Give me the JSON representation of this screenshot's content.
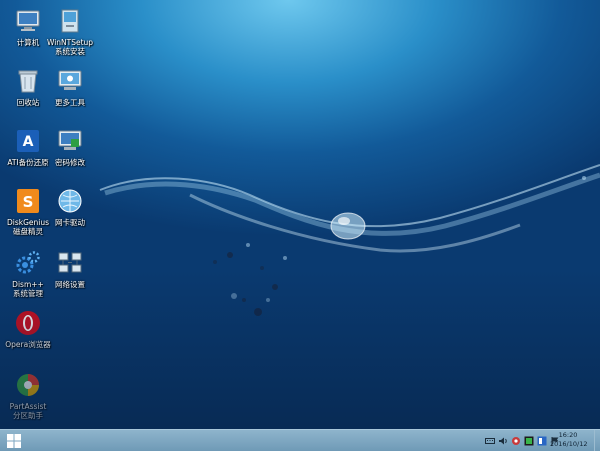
{
  "desktop": {
    "icons": [
      {
        "label_lines": [
          "计算机"
        ],
        "icon": "computer-icon"
      },
      {
        "label_lines": [
          "WinNTSetup",
          "系统安装"
        ],
        "icon": "setup-icon"
      },
      {
        "label_lines": [
          "回收站"
        ],
        "icon": "recycle-bin-icon"
      },
      {
        "label_lines": [
          "更多工具"
        ],
        "icon": "tools-icon"
      },
      {
        "label_lines": [
          "ATI备份还原"
        ],
        "icon": "backup-icon"
      },
      {
        "label_lines": [
          "密码修改"
        ],
        "icon": "password-icon"
      },
      {
        "label_lines": [
          "DiskGenius",
          "磁盘精灵"
        ],
        "icon": "diskgenius-icon"
      },
      {
        "label_lines": [
          "网卡驱动"
        ],
        "icon": "network-driver-icon"
      },
      {
        "label_lines": [
          "Dism++",
          "系统管理"
        ],
        "icon": "dism-icon"
      },
      {
        "label_lines": [
          "网络设置"
        ],
        "icon": "network-settings-icon"
      },
      {
        "label_lines": [
          "Opera浏览器"
        ],
        "icon": "opera-icon"
      },
      {
        "label_lines": [
          "PartAssist",
          "分区助手"
        ],
        "icon": "partassist-icon"
      }
    ]
  },
  "taskbar": {
    "start_icon": "windows-logo-icon",
    "tray_icons": [
      "keyboard-icon",
      "volume-icon",
      "network-icon",
      "app-icon",
      "app-icon",
      "flag-icon"
    ],
    "clock": {
      "time": "16:20",
      "date": "2016/10/12"
    }
  }
}
